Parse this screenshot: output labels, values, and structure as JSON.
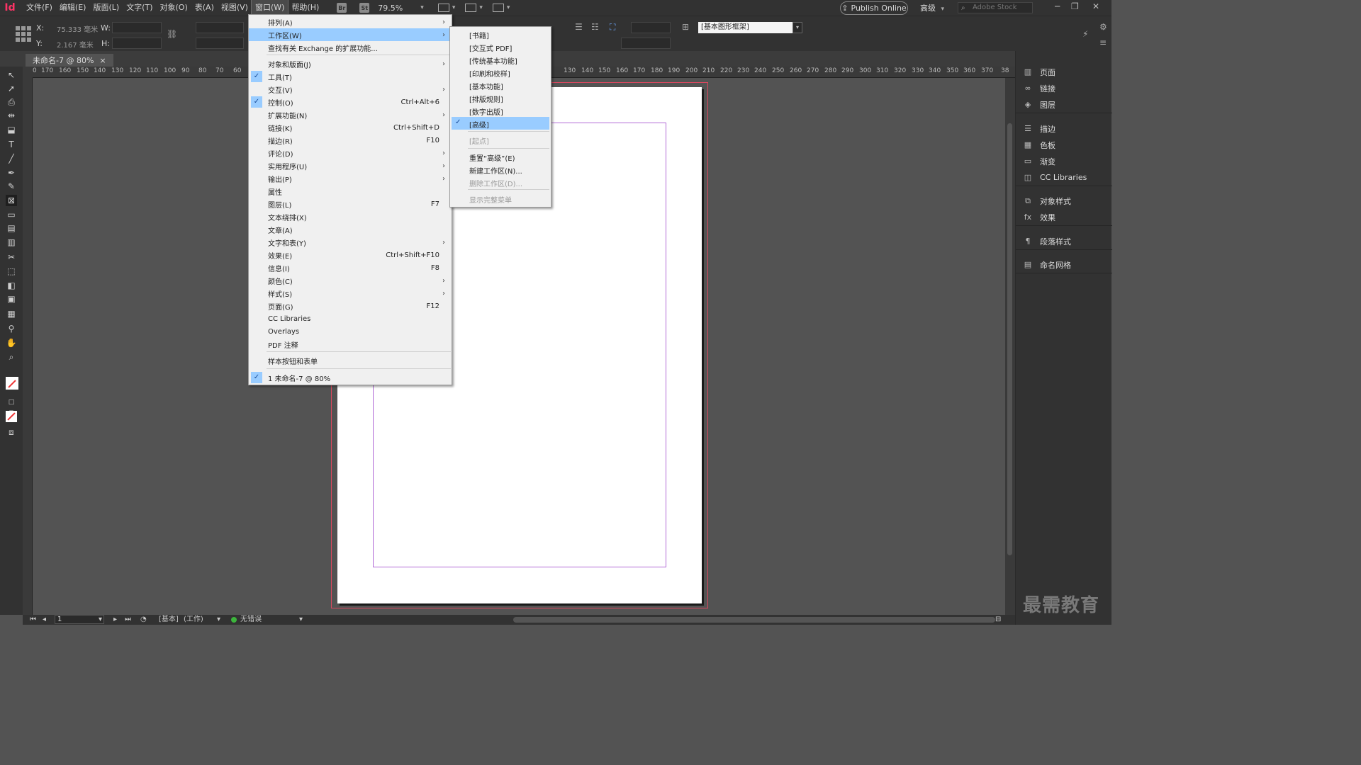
{
  "app": {
    "logo": "Id"
  },
  "menubar": {
    "items": [
      "文件(F)",
      "编辑(E)",
      "版面(L)",
      "文字(T)",
      "对象(O)",
      "表(A)",
      "视图(V)",
      "窗口(W)",
      "帮助(H)"
    ],
    "br_chip": "Br",
    "st_chip": "St",
    "zoom": "79.5%",
    "publish_label": "Publish Online",
    "workspace_label": "高级",
    "stock_placeholder": "Adobe Stock"
  },
  "control": {
    "x_label": "X:",
    "x_value": "75.333 毫米",
    "y_label": "Y:",
    "y_value": "2.167 毫米",
    "w_label": "W:",
    "h_label": "H:",
    "object_style": "[基本图形框架]"
  },
  "tab": {
    "title": "未命名-7 @ 80%",
    "close": "×"
  },
  "ruler_ticks": [
    "0",
    "170",
    "160",
    "150",
    "140",
    "130",
    "120",
    "110",
    "100",
    "90",
    "80",
    "70",
    "60",
    "130",
    "140",
    "150",
    "160",
    "170",
    "180",
    "190",
    "200",
    "210",
    "220",
    "230",
    "240",
    "250",
    "260",
    "270",
    "280",
    "290",
    "300",
    "310",
    "320",
    "330",
    "340",
    "350",
    "360",
    "370",
    "38"
  ],
  "window_menu": {
    "rows": [
      {
        "label": "排列(A)",
        "shortcut": "",
        "submenu": true,
        "checked": false,
        "highlight": false
      },
      {
        "label": "工作区(W)",
        "shortcut": "",
        "submenu": true,
        "checked": false,
        "highlight": true
      },
      {
        "label": "查找有关 Exchange 的扩展功能...",
        "shortcut": "",
        "submenu": false,
        "checked": false,
        "highlight": false
      },
      {
        "label": "对象和版面(J)",
        "shortcut": "",
        "submenu": true,
        "checked": false,
        "highlight": false
      },
      {
        "label": "工具(T)",
        "shortcut": "",
        "submenu": false,
        "checked": true,
        "highlight": false
      },
      {
        "label": "交互(V)",
        "shortcut": "",
        "submenu": true,
        "checked": false,
        "highlight": false
      },
      {
        "label": "控制(O)",
        "shortcut": "Ctrl+Alt+6",
        "submenu": false,
        "checked": true,
        "highlight": false
      },
      {
        "label": "扩展功能(N)",
        "shortcut": "",
        "submenu": true,
        "checked": false,
        "highlight": false
      },
      {
        "label": "链接(K)",
        "shortcut": "Ctrl+Shift+D",
        "submenu": false,
        "checked": false,
        "highlight": false
      },
      {
        "label": "描边(R)",
        "shortcut": "F10",
        "submenu": false,
        "checked": false,
        "highlight": false
      },
      {
        "label": "评论(D)",
        "shortcut": "",
        "submenu": true,
        "checked": false,
        "highlight": false
      },
      {
        "label": "实用程序(U)",
        "shortcut": "",
        "submenu": true,
        "checked": false,
        "highlight": false
      },
      {
        "label": "输出(P)",
        "shortcut": "",
        "submenu": true,
        "checked": false,
        "highlight": false
      },
      {
        "label": "属性",
        "shortcut": "",
        "submenu": false,
        "checked": false,
        "highlight": false
      },
      {
        "label": "图层(L)",
        "shortcut": "F7",
        "submenu": false,
        "checked": false,
        "highlight": false
      },
      {
        "label": "文本绕排(X)",
        "shortcut": "",
        "submenu": false,
        "checked": false,
        "highlight": false
      },
      {
        "label": "文章(A)",
        "shortcut": "",
        "submenu": false,
        "checked": false,
        "highlight": false
      },
      {
        "label": "文字和表(Y)",
        "shortcut": "",
        "submenu": true,
        "checked": false,
        "highlight": false
      },
      {
        "label": "效果(E)",
        "shortcut": "Ctrl+Shift+F10",
        "submenu": false,
        "checked": false,
        "highlight": false
      },
      {
        "label": "信息(I)",
        "shortcut": "F8",
        "submenu": false,
        "checked": false,
        "highlight": false
      },
      {
        "label": "颜色(C)",
        "shortcut": "",
        "submenu": true,
        "checked": false,
        "highlight": false
      },
      {
        "label": "样式(S)",
        "shortcut": "",
        "submenu": true,
        "checked": false,
        "highlight": false
      },
      {
        "label": "页面(G)",
        "shortcut": "F12",
        "submenu": false,
        "checked": false,
        "highlight": false
      },
      {
        "label": "CC Libraries",
        "shortcut": "",
        "submenu": false,
        "checked": false,
        "highlight": false
      },
      {
        "label": "Overlays",
        "shortcut": "",
        "submenu": false,
        "checked": false,
        "highlight": false
      },
      {
        "label": "PDF 注释",
        "shortcut": "",
        "submenu": false,
        "checked": false,
        "highlight": false
      },
      {
        "label": "样本按钮和表单",
        "shortcut": "",
        "submenu": false,
        "checked": false,
        "highlight": false
      },
      {
        "label": "1 未命名-7 @ 80%",
        "shortcut": "",
        "submenu": false,
        "checked": true,
        "highlight": false
      }
    ]
  },
  "workspace_submenu": {
    "rows": [
      {
        "label": "[书籍]",
        "checked": false,
        "highlight": false,
        "disabled": false
      },
      {
        "label": "[交互式 PDF]",
        "checked": false,
        "highlight": false,
        "disabled": false
      },
      {
        "label": "[传统基本功能]",
        "checked": false,
        "highlight": false,
        "disabled": false
      },
      {
        "label": "[印刷和校样]",
        "checked": false,
        "highlight": false,
        "disabled": false
      },
      {
        "label": "[基本功能]",
        "checked": false,
        "highlight": false,
        "disabled": false
      },
      {
        "label": "[排版规则]",
        "checked": false,
        "highlight": false,
        "disabled": false
      },
      {
        "label": "[数字出版]",
        "checked": false,
        "highlight": false,
        "disabled": false
      },
      {
        "label": "[高级]",
        "checked": true,
        "highlight": true,
        "disabled": false
      },
      {
        "label": "[起点]",
        "checked": false,
        "highlight": false,
        "disabled": true
      },
      {
        "label": "重置“高级”(E)",
        "checked": false,
        "highlight": false,
        "disabled": false
      },
      {
        "label": "新建工作区(N)...",
        "checked": false,
        "highlight": false,
        "disabled": false
      },
      {
        "label": "删除工作区(D)...",
        "checked": false,
        "highlight": false,
        "disabled": true
      },
      {
        "label": "显示完整菜单",
        "checked": false,
        "highlight": false,
        "disabled": true
      }
    ]
  },
  "panels": {
    "groups": [
      [
        {
          "label": "页面",
          "icon": "pages-icon"
        },
        {
          "label": "链接",
          "icon": "links-icon"
        },
        {
          "label": "图层",
          "icon": "layers-icon"
        }
      ],
      [
        {
          "label": "描边",
          "icon": "stroke-icon"
        },
        {
          "label": "色板",
          "icon": "swatches-icon"
        },
        {
          "label": "渐变",
          "icon": "gradient-icon"
        },
        {
          "label": "CC Libraries",
          "icon": "cc-libraries-icon"
        }
      ],
      [
        {
          "label": "对象样式",
          "icon": "object-styles-icon"
        },
        {
          "label": "效果",
          "icon": "effects-icon"
        }
      ],
      [
        {
          "label": "段落样式",
          "icon": "paragraph-styles-icon"
        }
      ],
      [
        {
          "label": "命名网格",
          "icon": "named-grids-icon"
        }
      ]
    ]
  },
  "status": {
    "page": "1",
    "preflight_profile": "[基本]",
    "preflight_mode": "(工作)",
    "errors": "无错误"
  },
  "watermark": "最需教育",
  "colors": {
    "accent": "#99ccff",
    "bleed": "#d9485f",
    "margin": "#b26bd6",
    "ok": "#3cb53c"
  }
}
